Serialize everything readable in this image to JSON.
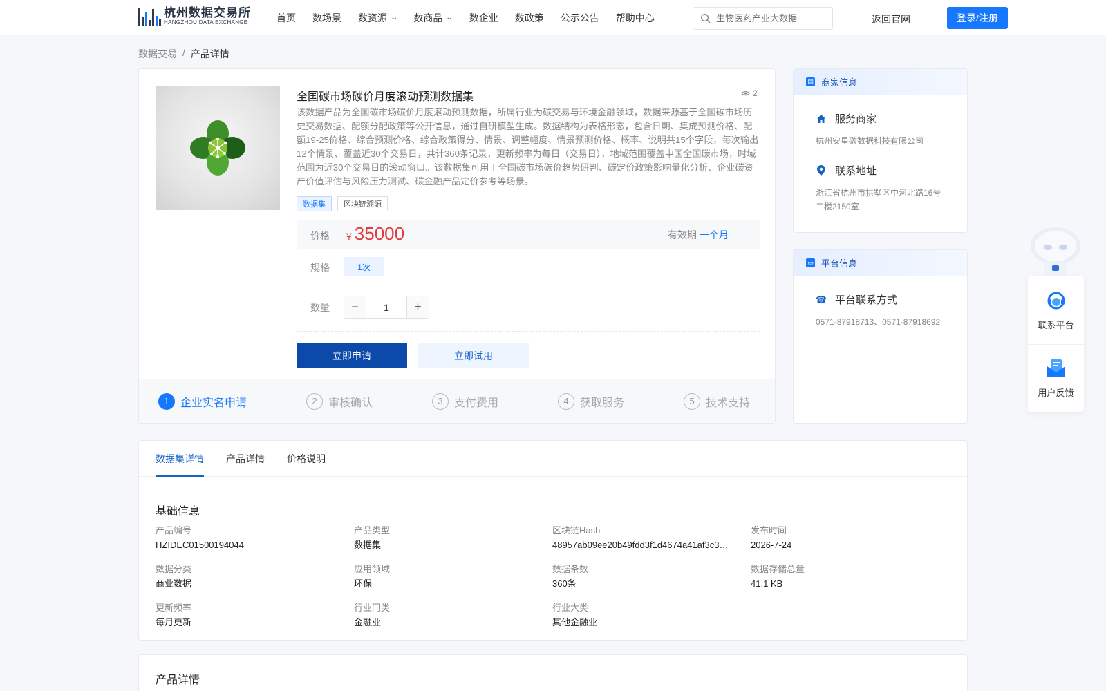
{
  "header": {
    "logo_cn": "杭州数据交易所",
    "logo_en": "HANGZHOU DATA EXCHANGE",
    "nav": [
      {
        "label": "首页",
        "dropdown": false
      },
      {
        "label": "数场景",
        "dropdown": false
      },
      {
        "label": "数资源",
        "dropdown": true
      },
      {
        "label": "数商品",
        "dropdown": true
      },
      {
        "label": "数企业",
        "dropdown": false
      },
      {
        "label": "数政策",
        "dropdown": false
      },
      {
        "label": "公示公告",
        "dropdown": false
      },
      {
        "label": "帮助中心",
        "dropdown": false
      }
    ],
    "search_placeholder": "生物医药产业大数据",
    "back_label": "返回官网",
    "login_label": "登录/注册"
  },
  "breadcrumb": {
    "parent": "数据交易",
    "sep": "/",
    "current": "产品详情"
  },
  "product": {
    "title": "全国碳市场碳价月度滚动预测数据集",
    "views": "2",
    "description": "该数据产品为全国碳市场碳价月度滚动预测数据，所属行业为碳交易与环境金融领域，数据来源基于全国碳市场历史交易数据、配额分配政策等公开信息，通过自研模型生成。数据结构为表格形态，包含日期、集成预测价格、配额19-25价格、综合预测价格、综合政策得分、情景、调整幅度、情景预测价格、概率、说明共15个字段，每次输出12个情景、覆盖近30个交易日，共计360条记录，更新频率为每日（交易日），地域范围覆盖中国全国碳市场，时域范围为近30个交易日的滚动窗口。该数据集可用于全国碳市场碳价趋势研判、碳定价政策影响量化分析、企业碳资产价值评估与风险压力测试、碳金融产品定价参考等场景。",
    "tags": [
      "数据集",
      "区块链溯源"
    ],
    "price_label": "价格",
    "currency": "¥",
    "price": "35000",
    "validity_label": "有效期",
    "validity_value": "一个月",
    "spec_label": "规格",
    "spec_value": "1次",
    "qty_label": "数量",
    "qty_value": "1",
    "apply_label": "立即申请",
    "trial_label": "立即试用",
    "steps": [
      {
        "num": "1",
        "label": "企业实名申请"
      },
      {
        "num": "2",
        "label": "审核确认"
      },
      {
        "num": "3",
        "label": "支付费用"
      },
      {
        "num": "4",
        "label": "获取服务"
      },
      {
        "num": "5",
        "label": "技术支持"
      }
    ]
  },
  "merchant": {
    "head": "商家信息",
    "service_title": "服务商家",
    "service_value": "杭州安星碳数据科技有限公司",
    "addr_title": "联系地址",
    "addr_value": "浙江省杭州市拱墅区中河北路16号二楼2150室"
  },
  "platform": {
    "head": "平台信息",
    "contact_title": "平台联系方式",
    "contact_value": "0571-87918713、0571-87918692"
  },
  "float": {
    "contact_label": "联系平台",
    "feedback_label": "用户反馈"
  },
  "tabs": [
    "数据集详情",
    "产品详情",
    "价格说明"
  ],
  "basic": {
    "title": "基础信息",
    "items": [
      {
        "k": "产品编号",
        "v": "HZIDEC01500194044"
      },
      {
        "k": "产品类型",
        "v": "数据集"
      },
      {
        "k": "区块链Hash",
        "v": "48957ab09ee20b49fdd3f1d4674a41af3c3…"
      },
      {
        "k": "发布时间",
        "v": "2026-7-24"
      },
      {
        "k": "数据分类",
        "v": "商业数据"
      },
      {
        "k": "应用领域",
        "v": "环保"
      },
      {
        "k": "数据条数",
        "v": "360条"
      },
      {
        "k": "数据存储总量",
        "v": "41.1 KB"
      },
      {
        "k": "更新频率",
        "v": "每月更新"
      },
      {
        "k": "行业门类",
        "v": "金融业"
      },
      {
        "k": "行业大类",
        "v": "其他金融业"
      }
    ]
  },
  "detail_title": "产品详情",
  "colors": {
    "accent": "#1677ff",
    "primary_button": "#0b4aa8",
    "price": "#e4393c"
  }
}
